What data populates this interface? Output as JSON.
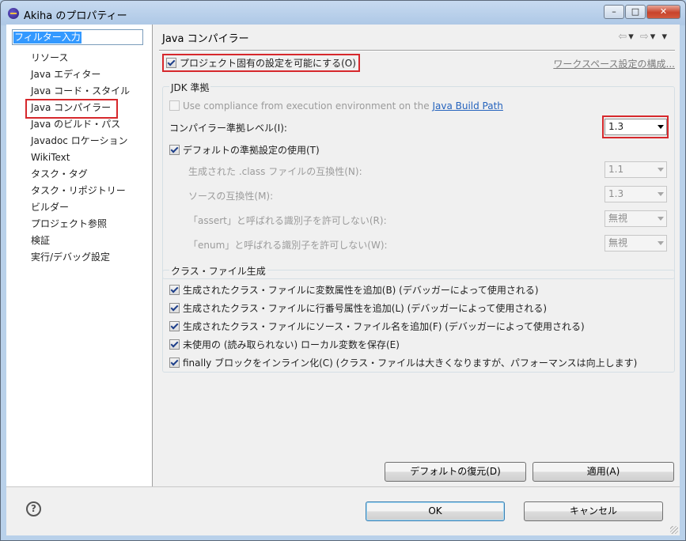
{
  "window": {
    "title": "Akiha のプロパティー",
    "min": "–",
    "max": "□",
    "close": "✕"
  },
  "filter": {
    "value": "フィルター入力"
  },
  "nav": {
    "items": [
      "リソース",
      "Java エディター",
      "Java コード・スタイル",
      "Java コンパイラー",
      "Java のビルド・パス",
      "Javadoc ロケーション",
      "WikiText",
      "タスク・タグ",
      "タスク・リポジトリー",
      "ビルダー",
      "プロジェクト参照",
      "検証",
      "実行/デバッグ設定"
    ],
    "selected_index": 3
  },
  "page": {
    "title": "Java コンパイラー",
    "back": "⇦",
    "forward": "⇨",
    "menu": "▾",
    "project_specific": "プロジェクト固有の設定を可能にする(O)",
    "workspace_link": "ワークスペース設定の構成..."
  },
  "jdk": {
    "group_title": "JDK 準拠",
    "use_env_prefix": "Use compliance from execution environment on the ",
    "use_env_link": "Java Build Path",
    "level_label": "コンパイラー準拠レベル(I):",
    "level_value": "1.3",
    "use_default": "デフォルトの準拠設定の使用(T)",
    "class_compat_label": "生成された .class ファイルの互換性(N):",
    "class_compat_value": "1.1",
    "source_compat_label": "ソースの互換性(M):",
    "source_compat_value": "1.3",
    "assert_label": "「assert」と呼ばれる識別子を許可しない(R):",
    "assert_value": "無視",
    "enum_label": "「enum」と呼ばれる識別子を許可しない(W):",
    "enum_value": "無視"
  },
  "classfile": {
    "group_title": "クラス・ファイル生成",
    "options": [
      "生成されたクラス・ファイルに変数属性を追加(B) (デバッガーによって使用される)",
      "生成されたクラス・ファイルに行番号属性を追加(L) (デバッガーによって使用される)",
      "生成されたクラス・ファイルにソース・ファイル名を追加(F) (デバッガーによって使用される)",
      "未使用の (読み取られない) ローカル変数を保存(E)",
      "finally ブロックをインライン化(C) (クラス・ファイルは大きくなりますが、パフォーマンスは向上します)"
    ]
  },
  "buttons": {
    "restore": "デフォルトの復元(D)",
    "apply": "適用(A)",
    "ok": "OK",
    "cancel": "キャンセル",
    "help": "?"
  }
}
